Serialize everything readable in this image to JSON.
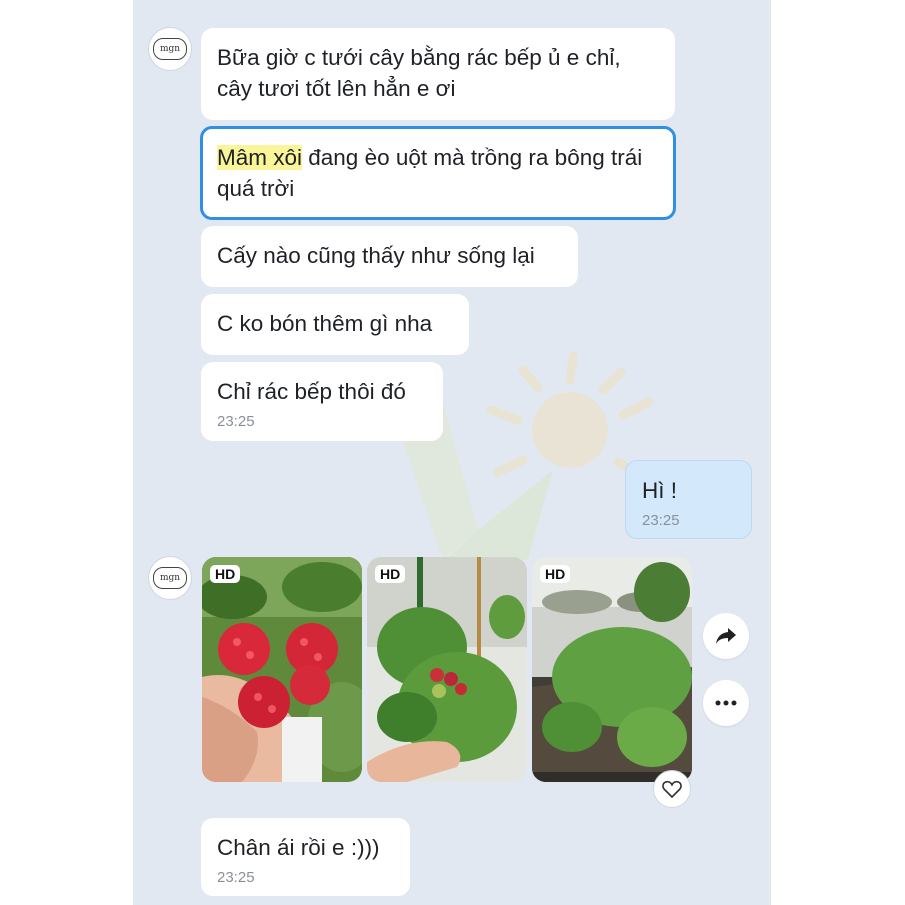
{
  "contact": {
    "avatar_text": "mgn"
  },
  "messages": [
    {
      "text": "Bữa giờ c tưới cây bằng rác bếp ủ e chỉ, cây tươi tốt lên hẳn e ơi"
    },
    {
      "highlight": "Mâm xôi",
      "text": " đang èo uột mà trồng ra bông trái quá trời"
    },
    {
      "text": "Cấy nào cũng thấy như sống lại"
    },
    {
      "text": "C ko bón thêm gì nha"
    },
    {
      "text": "Chỉ rác bếp thôi đó",
      "time": "23:25"
    }
  ],
  "my_message": {
    "text": "Hì !",
    "time": "23:25"
  },
  "photos": [
    {
      "badge": "HD",
      "subject": "red raspberries in hand"
    },
    {
      "badge": "HD",
      "subject": "raspberry plant with green fruit"
    },
    {
      "badge": "HD",
      "subject": "vegetable planter bed"
    }
  ],
  "last_message": {
    "text": "Chân ái rồi e :)))",
    "time": "23:25"
  },
  "icons": {
    "share": "share-arrow-icon",
    "more": "more-dots-icon",
    "react": "heart-icon"
  },
  "colors": {
    "chat_bg": "#e2e8f1",
    "bubble": "#ffffff",
    "my_bubble": "#d4e8fb",
    "selected_border": "#2f8fe2",
    "highlight": "#fbf59a"
  }
}
